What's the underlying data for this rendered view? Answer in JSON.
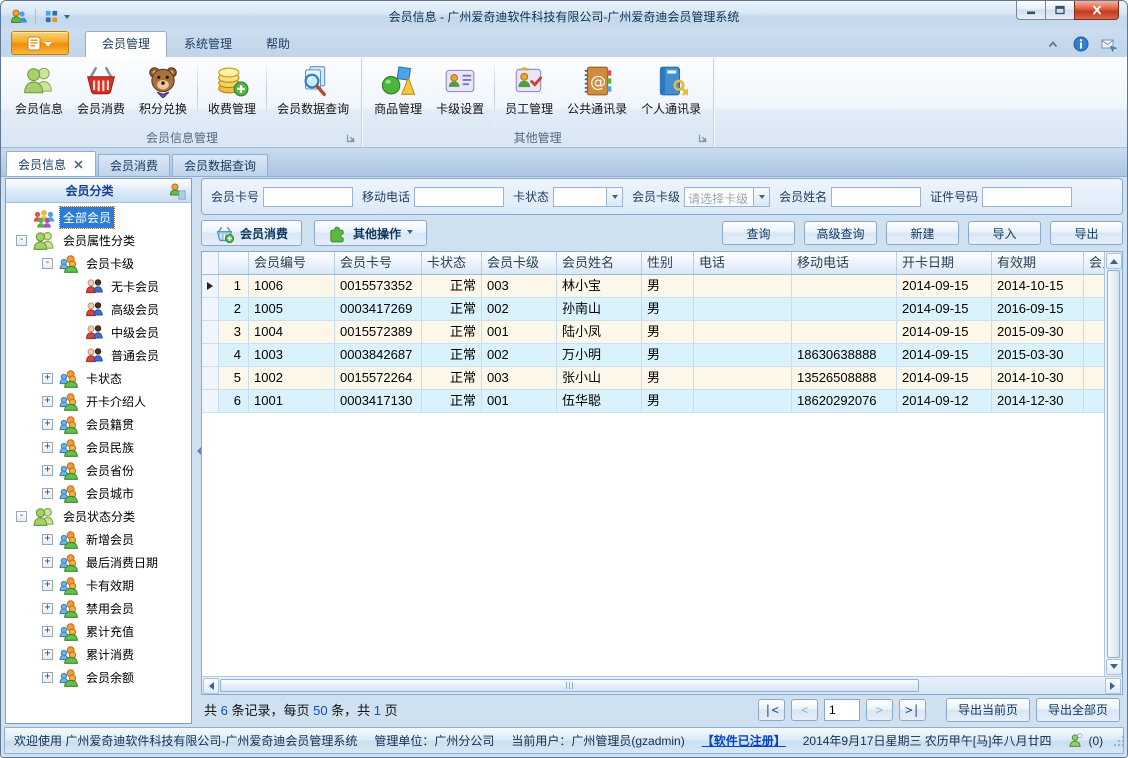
{
  "window": {
    "title": "会员信息 - 广州爱奇迪软件科技有限公司-广州爱奇迪会员管理系统"
  },
  "colors": {
    "accent_orange": "#f7a928",
    "selection_blue": "#2b7cd9",
    "row_odd": "#fcf7e9",
    "row_even": "#daf2fc",
    "link_blue": "#0443c6",
    "close_red": "#c03a1e"
  },
  "ribbon": {
    "tabs": [
      {
        "label": "会员管理",
        "active": true
      },
      {
        "label": "系统管理"
      },
      {
        "label": "帮助"
      }
    ],
    "tools": [
      {
        "icon": "collapse-ribbon-icon"
      },
      {
        "icon": "info-icon"
      },
      {
        "icon": "feedback-icon"
      }
    ],
    "groups": [
      {
        "label": "会员信息管理",
        "items": [
          {
            "label": "会员信息",
            "icon": "members-icon"
          },
          {
            "label": "会员消费",
            "icon": "basket-icon"
          },
          {
            "label": "积分兑换",
            "icon": "teddy-icon",
            "sep_after": true
          },
          {
            "label": "收费管理",
            "icon": "coins-icon",
            "sep_after": true
          },
          {
            "label": "会员数据查询",
            "icon": "data-search-icon"
          }
        ]
      },
      {
        "label": "其他管理",
        "items": [
          {
            "label": "商品管理",
            "icon": "products-icon"
          },
          {
            "label": "卡级设置",
            "icon": "card-level-icon",
            "sep_after": true
          },
          {
            "label": "员工管理",
            "icon": "staff-icon"
          },
          {
            "label": "公共通讯录",
            "icon": "public-contacts-icon"
          },
          {
            "label": "个人通讯录",
            "icon": "personal-contacts-icon"
          }
        ]
      }
    ]
  },
  "doc_tabs": [
    {
      "label": "会员信息",
      "active": true,
      "closable": true
    },
    {
      "label": "会员消费"
    },
    {
      "label": "会员数据查询"
    }
  ],
  "sidebar": {
    "header": "会员分类",
    "header_icon": "category-settings-icon",
    "tree": [
      {
        "label": "全部会员",
        "level": 0,
        "icon": "all-members-icon",
        "expander": "none",
        "selected": true
      },
      {
        "label": "会员属性分类",
        "level": 0,
        "icon": "green-group-icon",
        "expander": "minus"
      },
      {
        "label": "会员卡级",
        "level": 1,
        "icon": "orange-group-icon",
        "expander": "minus"
      },
      {
        "label": "无卡会员",
        "level": 2,
        "icon": "member-pair-icon",
        "expander": "none"
      },
      {
        "label": "高级会员",
        "level": 2,
        "icon": "member-pair-icon",
        "expander": "none"
      },
      {
        "label": "中级会员",
        "level": 2,
        "icon": "member-pair-icon",
        "expander": "none"
      },
      {
        "label": "普通会员",
        "level": 2,
        "icon": "member-pair-icon",
        "expander": "none"
      },
      {
        "label": "卡状态",
        "level": 1,
        "icon": "orange-group-icon",
        "expander": "plus"
      },
      {
        "label": "开卡介绍人",
        "level": 1,
        "icon": "orange-group-icon",
        "expander": "plus"
      },
      {
        "label": "会员籍贯",
        "level": 1,
        "icon": "orange-group-icon",
        "expander": "plus"
      },
      {
        "label": "会员民族",
        "level": 1,
        "icon": "orange-group-icon",
        "expander": "plus"
      },
      {
        "label": "会员省份",
        "level": 1,
        "icon": "orange-group-icon",
        "expander": "plus"
      },
      {
        "label": "会员城市",
        "level": 1,
        "icon": "orange-group-icon",
        "expander": "plus"
      },
      {
        "label": "会员状态分类",
        "level": 0,
        "icon": "green-group-icon",
        "expander": "minus"
      },
      {
        "label": "新增会员",
        "level": 1,
        "icon": "orange-group-icon",
        "expander": "plus"
      },
      {
        "label": "最后消费日期",
        "level": 1,
        "icon": "orange-group-icon",
        "expander": "plus"
      },
      {
        "label": "卡有效期",
        "level": 1,
        "icon": "orange-group-icon",
        "expander": "plus"
      },
      {
        "label": "禁用会员",
        "level": 1,
        "icon": "orange-group-icon",
        "expander": "plus"
      },
      {
        "label": "累计充值",
        "level": 1,
        "icon": "orange-group-icon",
        "expander": "plus"
      },
      {
        "label": "累计消费",
        "level": 1,
        "icon": "orange-group-icon",
        "expander": "plus"
      },
      {
        "label": "会员余额",
        "level": 1,
        "icon": "orange-group-icon",
        "expander": "plus"
      }
    ]
  },
  "search": {
    "fields": [
      {
        "label": "会员卡号",
        "type": "text",
        "value": ""
      },
      {
        "label": "移动电话",
        "type": "text",
        "value": ""
      },
      {
        "label": "卡状态",
        "type": "select",
        "value": ""
      },
      {
        "label": "会员卡级",
        "type": "select",
        "value": "",
        "placeholder": "请选择卡级"
      },
      {
        "label": "会员姓名",
        "type": "text",
        "value": ""
      },
      {
        "label": "证件号码",
        "type": "text",
        "value": ""
      }
    ]
  },
  "toolbar": {
    "left": [
      {
        "label": "会员消费",
        "icon": "basket-add-icon"
      },
      {
        "label": "其他操作",
        "icon": "puzzle-icon",
        "dropdown": true
      }
    ],
    "right": [
      "查询",
      "高级查询",
      "新建",
      "导入",
      "导出"
    ]
  },
  "grid": {
    "columns": [
      "会员编号",
      "会员卡号",
      "卡状态",
      "会员卡级",
      "会员姓名",
      "性别",
      "电话",
      "移动电话",
      "开卡日期",
      "有效期",
      "会员"
    ],
    "rows": [
      {
        "num": "1",
        "current": true,
        "cells": [
          "1006",
          "0015573352",
          "正常",
          "003",
          "林小宝",
          "男",
          "",
          "",
          "2014-09-15",
          "2014-10-15",
          ""
        ]
      },
      {
        "num": "2",
        "cells": [
          "1005",
          "0003417269",
          "正常",
          "002",
          "孙南山",
          "男",
          "",
          "",
          "2014-09-15",
          "2016-09-15",
          ""
        ]
      },
      {
        "num": "3",
        "cells": [
          "1004",
          "0015572389",
          "正常",
          "001",
          "陆小凤",
          "男",
          "",
          "",
          "2014-09-15",
          "2015-09-30",
          ""
        ]
      },
      {
        "num": "4",
        "cells": [
          "1003",
          "0003842687",
          "正常",
          "002",
          "万小明",
          "男",
          "",
          "18630638888",
          "2014-09-15",
          "2015-03-30",
          ""
        ]
      },
      {
        "num": "5",
        "cells": [
          "1002",
          "0015572264",
          "正常",
          "003",
          "张小山",
          "男",
          "",
          "13526508888",
          "2014-09-15",
          "2014-10-30",
          ""
        ]
      },
      {
        "num": "6",
        "cells": [
          "1001",
          "0003417130",
          "正常",
          "001",
          "伍华聪",
          "男",
          "",
          "18620292076",
          "2014-09-12",
          "2014-12-30",
          ""
        ]
      }
    ]
  },
  "pagination": {
    "summary": [
      {
        "t": "共 "
      },
      {
        "t": "6",
        "n": true
      },
      {
        "t": " 条记录，每页 "
      },
      {
        "t": "50",
        "n": true
      },
      {
        "t": " 条，共 "
      },
      {
        "t": "1",
        "n": true
      },
      {
        "t": " 页"
      }
    ],
    "pager": {
      "first": "|<",
      "prev": "<",
      "page": "1",
      "next": ">",
      "last": ">|"
    },
    "export_current": "导出当前页",
    "export_all": "导出全部页"
  },
  "status": {
    "welcome": "欢迎使用 广州爱奇迪软件科技有限公司-广州爱奇迪会员管理系统",
    "org": "管理单位：广州分公司",
    "user": "当前用户：广州管理员(gzadmin)",
    "registered": "【软件已注册】",
    "date": "2014年9月17日星期三 农历甲午[马]年八月廿四",
    "messages": "(0)"
  }
}
